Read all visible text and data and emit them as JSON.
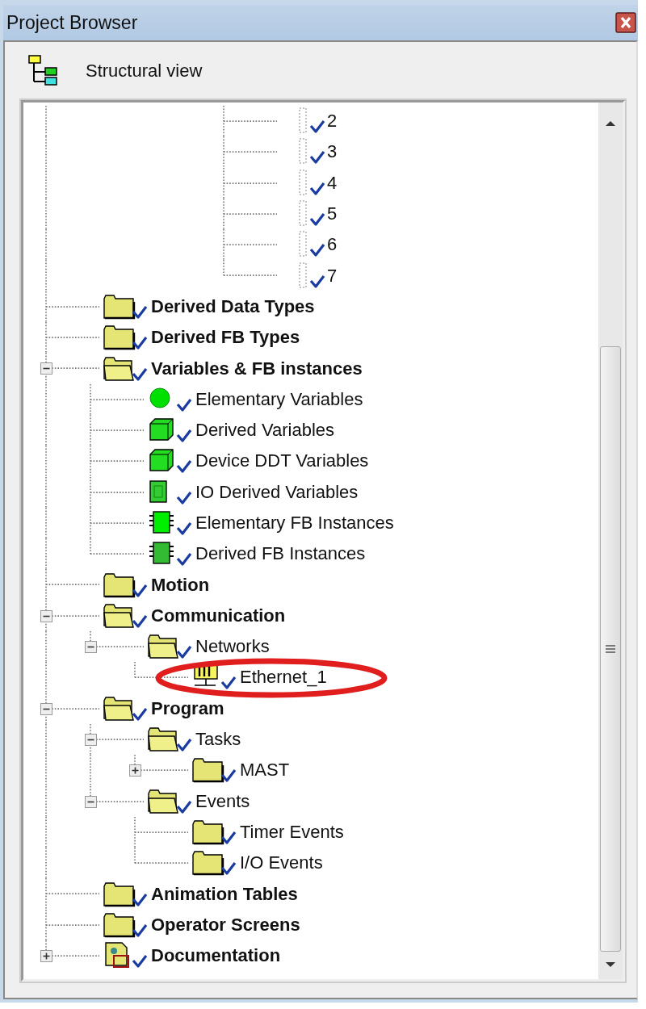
{
  "window": {
    "title": "Project Browser"
  },
  "toolbar": {
    "view_label": "Structural view"
  },
  "tree": [
    {
      "children": [
        {
          "children": [
            {
              "children": [
                {
                  "children": [
                    {
                      "children": [
                        {
                          "label": "2",
                          "kind": "element"
                        },
                        {
                          "label": "3",
                          "kind": "element"
                        },
                        {
                          "label": "4",
                          "kind": "element"
                        },
                        {
                          "label": "5",
                          "kind": "element"
                        },
                        {
                          "label": "6",
                          "kind": "element"
                        },
                        {
                          "label": "7",
                          "kind": "element"
                        }
                      ]
                    }
                  ]
                }
              ]
            }
          ]
        },
        {
          "label": "Derived Data Types",
          "kind": "folder"
        },
        {
          "label": "Derived FB Types",
          "kind": "folder"
        },
        {
          "label": "Variables & FB instances",
          "kind": "folder",
          "expanded": true,
          "children": [
            {
              "label": "Elementary Variables",
              "kind": "variable"
            },
            {
              "label": "Derived Variables",
              "kind": "cube"
            },
            {
              "label": "Device DDT Variables",
              "kind": "cube"
            },
            {
              "label": "IO Derived Variables",
              "kind": "io"
            },
            {
              "label": "Elementary FB Instances",
              "kind": "chip"
            },
            {
              "label": "Derived FB Instances",
              "kind": "fb"
            }
          ]
        },
        {
          "label": "Motion",
          "kind": "folder"
        },
        {
          "label": "Communication",
          "kind": "folder",
          "expanded": true,
          "children": [
            {
              "label": "Networks",
              "kind": "folder",
              "expanded": true,
              "children": [
                {
                  "label": "Ethernet_1",
                  "kind": "network"
                }
              ]
            }
          ]
        },
        {
          "label": "Program",
          "kind": "folder",
          "expanded": true,
          "children": [
            {
              "label": "Tasks",
              "kind": "folder",
              "expanded": true,
              "children": [
                {
                  "label": "MAST",
                  "kind": "folder",
                  "expanded": false
                }
              ]
            },
            {
              "label": "Events",
              "kind": "folder",
              "expanded": true,
              "children": [
                {
                  "label": "Timer Events",
                  "kind": "folder"
                },
                {
                  "label": "I/O Events",
                  "kind": "folder"
                }
              ]
            }
          ]
        },
        {
          "label": "Animation Tables",
          "kind": "folder"
        },
        {
          "label": "Operator Screens",
          "kind": "folder"
        },
        {
          "label": "Documentation",
          "kind": "documentation",
          "expanded": false
        }
      ]
    }
  ]
}
